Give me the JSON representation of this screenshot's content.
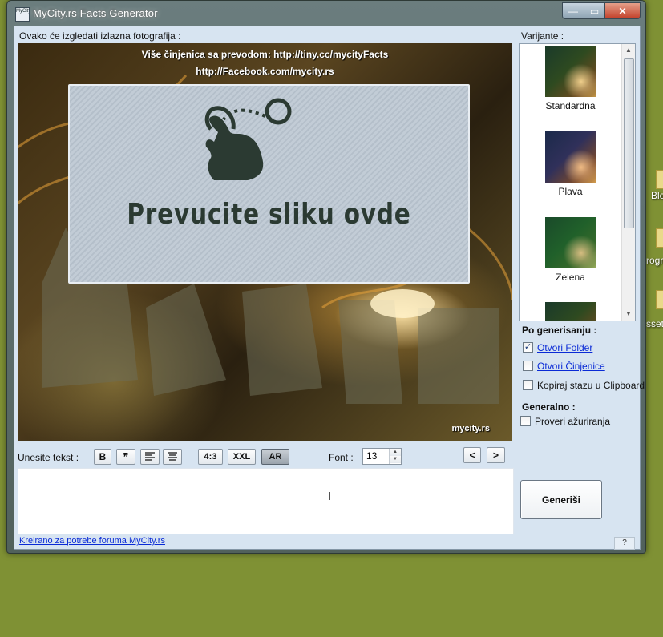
{
  "window": {
    "title": "MyCity.rs Facts Generator",
    "app_icon_text": "MyCity",
    "controls": {
      "minimize": "—",
      "maximize": "▭",
      "close": "✕"
    }
  },
  "preview": {
    "label": "Ovako će izgledati izlazna fotografija :",
    "header_line1": "Više činjenica sa prevodom: http://tiny.cc/mycityFacts",
    "header_line2": "http://Facebook.com/mycity.rs",
    "drop_text": "Prevucite sliku ovde",
    "watermark": "mycity.rs"
  },
  "variants": {
    "label": "Varijante :",
    "items": [
      {
        "name": "Standardna"
      },
      {
        "name": "Plava"
      },
      {
        "name": "Zelena"
      }
    ]
  },
  "after_generate": {
    "title": "Po generisanju :",
    "open_folder": {
      "label": "Otvori Folder",
      "checked": true
    },
    "open_facts": {
      "label": "Otvori Činjenice",
      "checked": false
    },
    "copy_path": {
      "label": "Kopiraj stazu u Clipboard",
      "checked": false
    }
  },
  "general": {
    "title": "Generalno :",
    "check_updates": {
      "label": "Proveri ažuriranja",
      "checked": false
    }
  },
  "toolbar": {
    "text_label": "Unesite tekst :",
    "bold": "B",
    "quote": "❞",
    "ratio": "4:3",
    "size": "XXL",
    "ar": "AR",
    "font_label": "Font :",
    "font_size": "13",
    "prev": "<",
    "next": ">"
  },
  "generate_button": "Generiši",
  "footer": {
    "link": "Kreirano za potrebe foruma MyCity.rs",
    "help": "?"
  },
  "desktop": {
    "items": [
      "Ble",
      "rogr",
      "sset"
    ]
  }
}
